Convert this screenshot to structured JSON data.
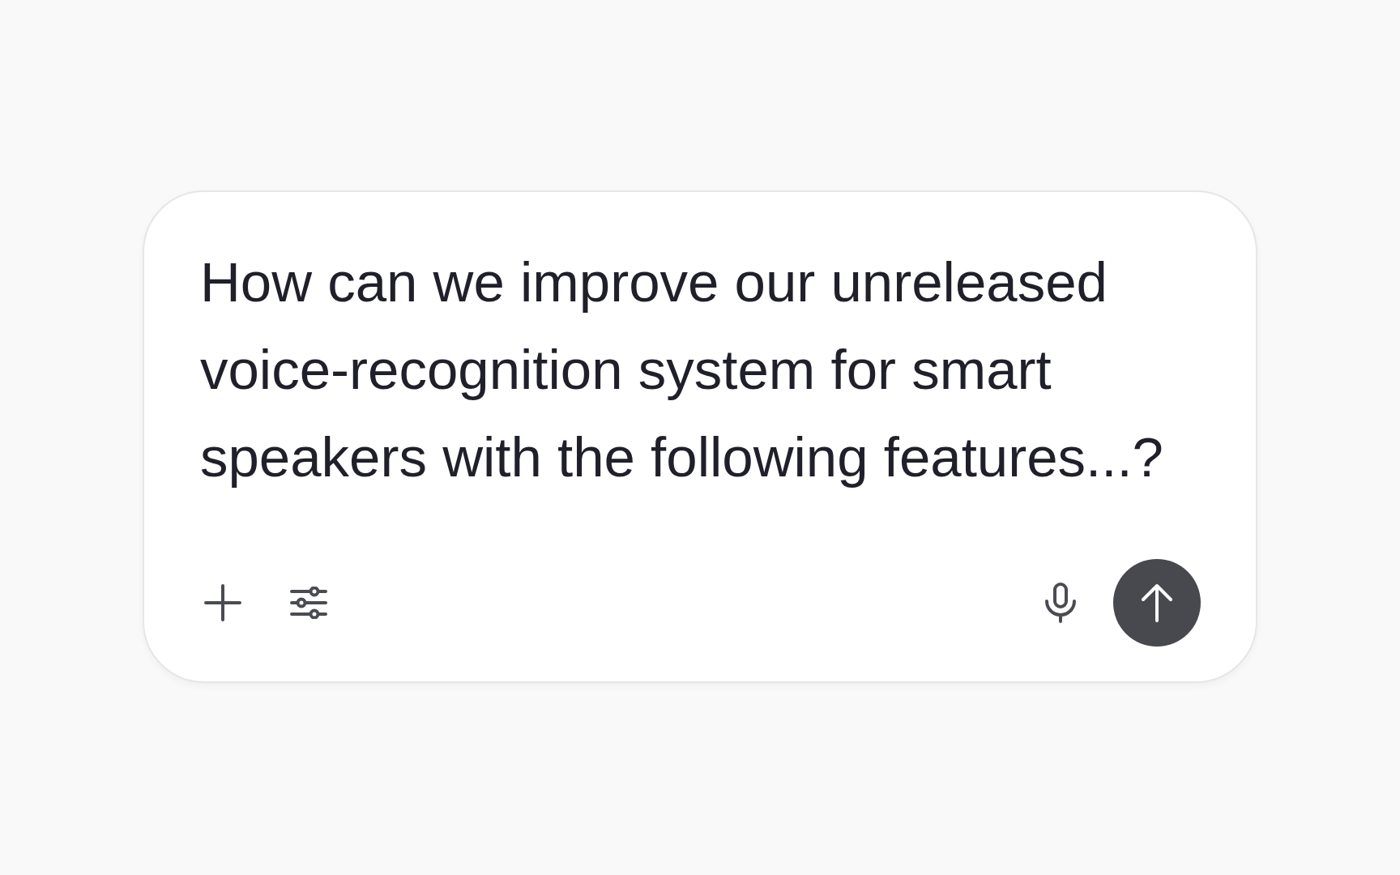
{
  "composer": {
    "prompt": {
      "value": "How can we improve our unreleased voice-recognition system for smart speakers with the following features...?"
    }
  }
}
